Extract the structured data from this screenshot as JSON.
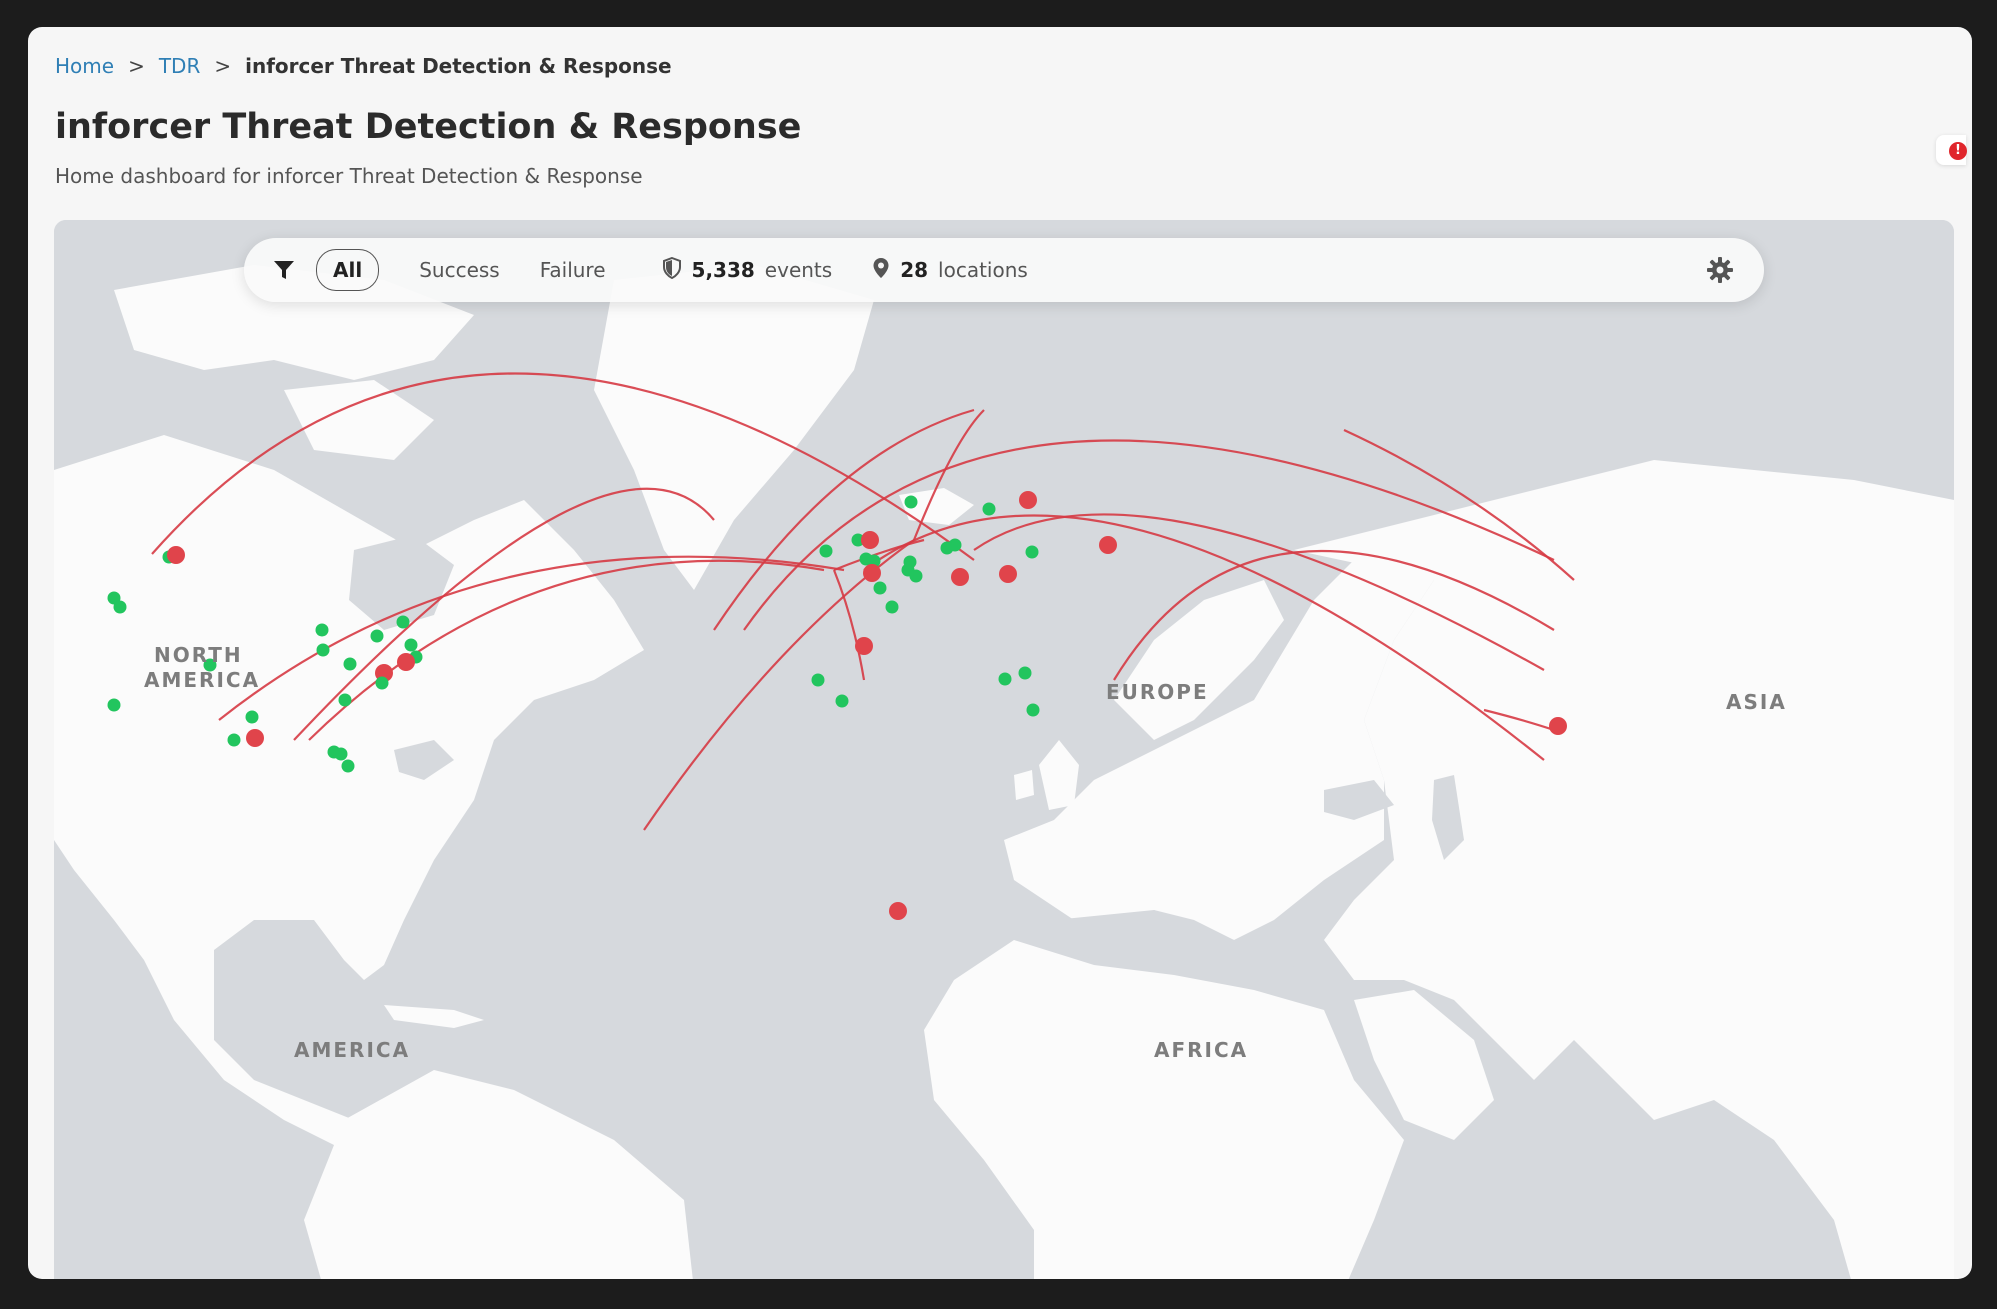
{
  "breadcrumb": {
    "home": "Home",
    "section": "TDR",
    "current": "inforcer Threat Detection & Response",
    "separator": ">"
  },
  "page": {
    "title": "inforcer Threat Detection & Response",
    "subtitle": "Home dashboard for inforcer Threat Detection & Response"
  },
  "notification": {
    "glyph": "!"
  },
  "toolbar": {
    "filter_icon": "filter-icon",
    "tabs": {
      "all": "All",
      "success": "Success",
      "failure": "Failure"
    },
    "selected_tab": "All",
    "events": {
      "icon": "shield-icon",
      "count": "5,338",
      "label": "events"
    },
    "locations": {
      "icon": "map-pin-icon",
      "count": "28",
      "label": "locations"
    },
    "settings_icon": "gear-icon"
  },
  "map": {
    "labels": {
      "north_america_line1": "NORTH",
      "north_america_line2": "AMERICA",
      "south_america": "AMERICA",
      "europe": "EUROPE",
      "africa": "AFRICA",
      "asia": "ASIA"
    }
  },
  "colors": {
    "success": "#22c55e",
    "failure": "#e0444b",
    "arc": "#d63a44",
    "ocean": "#d6d9dd",
    "land": "#fbfbfb"
  }
}
